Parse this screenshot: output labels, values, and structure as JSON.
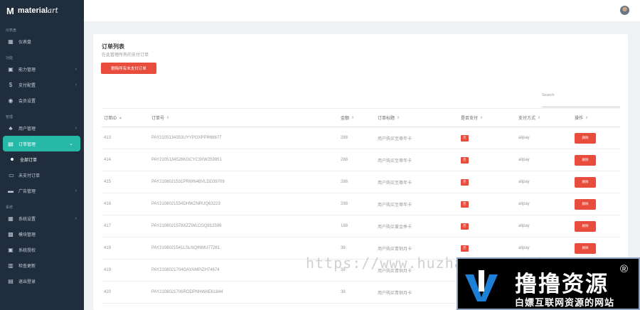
{
  "brand": {
    "name": "material",
    "suffix": "art"
  },
  "sidebar": {
    "sections": {
      "dashboard": "仪表盘",
      "features": "功能",
      "manage": "管理",
      "system": "系统"
    },
    "items": [
      {
        "label": "仪表盘",
        "icon": "dashboard-icon"
      },
      {
        "label": "能力管理",
        "icon": "cart-icon"
      },
      {
        "label": "支付配置",
        "icon": "dollar-icon"
      },
      {
        "label": "会员设置",
        "icon": "member-icon"
      },
      {
        "label": "用户管理",
        "icon": "users-icon"
      },
      {
        "label": "订单管理",
        "icon": "cart-icon"
      },
      {
        "label": "全部订单",
        "icon": "dot-icon"
      },
      {
        "label": "未支付订单",
        "icon": "monitor-icon"
      },
      {
        "label": "广告管理",
        "icon": "ad-icon"
      },
      {
        "label": "系统设置",
        "icon": "settings-icon"
      },
      {
        "label": "模块管理",
        "icon": "module-icon"
      },
      {
        "label": "系统授权",
        "icon": "auth-icon"
      },
      {
        "label": "检查更新",
        "icon": "update-icon"
      },
      {
        "label": "退出登录",
        "icon": "logout-icon"
      }
    ]
  },
  "card": {
    "title": "订单列表",
    "subtitle": "在此管理所有的支付订单",
    "delete_unpaid_label": "删除所有未支付订单",
    "search_placeholder": "Search"
  },
  "table": {
    "headers": [
      "订单ID",
      "订单号",
      "金额",
      "订单标题",
      "是否支付",
      "支付方式",
      "操作"
    ],
    "rows": [
      {
        "id": "413",
        "order_no": "PAY2105134353UYYPOXPPR66677",
        "amount": "288",
        "title": "用户购买至尊年卡",
        "paid": "否",
        "method": "alipay",
        "action": "删除"
      },
      {
        "id": "414",
        "order_no": "PAY2105134526KGCYC3XW259951",
        "amount": "288",
        "title": "用户购买至尊年卡",
        "paid": "否",
        "method": "alipay",
        "action": "删除"
      },
      {
        "id": "415",
        "order_no": "PAY2108021531PRWN4BVLDD39709",
        "amount": "288",
        "title": "用户购买至尊年卡",
        "paid": "否",
        "method": "alipay",
        "action": "删除"
      },
      {
        "id": "416",
        "order_no": "PAY2108021534DHWZNRUQ63223",
        "amount": "288",
        "title": "用户购买至尊年卡",
        "paid": "否",
        "method": "alipay",
        "action": "删除"
      },
      {
        "id": "417",
        "order_no": "PAY2108021578XZZWLCGQ812599",
        "amount": "168",
        "title": "用户购买黄金季卡",
        "paid": "否",
        "method": "alipay",
        "action": "删除"
      },
      {
        "id": "418",
        "order_no": "PAY2108021541LSLNQINMU77261",
        "amount": "38",
        "title": "用户购买青铜月卡",
        "paid": "否",
        "method": "alipay",
        "action": "删除"
      },
      {
        "id": "419",
        "order_no": "PAY2108021704OAYAMPIZH74674",
        "amount": "38",
        "title": "用户购买青铜月卡",
        "paid": "",
        "method": "",
        "action": ""
      },
      {
        "id": "420",
        "order_no": "PAY2108021706RODPNHWAE61844",
        "amount": "38",
        "title": "用户购买青铜月卡",
        "paid": "",
        "method": "",
        "action": ""
      }
    ]
  },
  "watermark": {
    "url": "https://www.huzhan.com/ishop4009",
    "name": "撸撸资源",
    "reg": "®",
    "tagline": "白嫖互联网资源的网站"
  },
  "colors": {
    "sidebar": "#1f2d3d",
    "accent": "#27b9a8",
    "danger": "#e74c3c"
  }
}
